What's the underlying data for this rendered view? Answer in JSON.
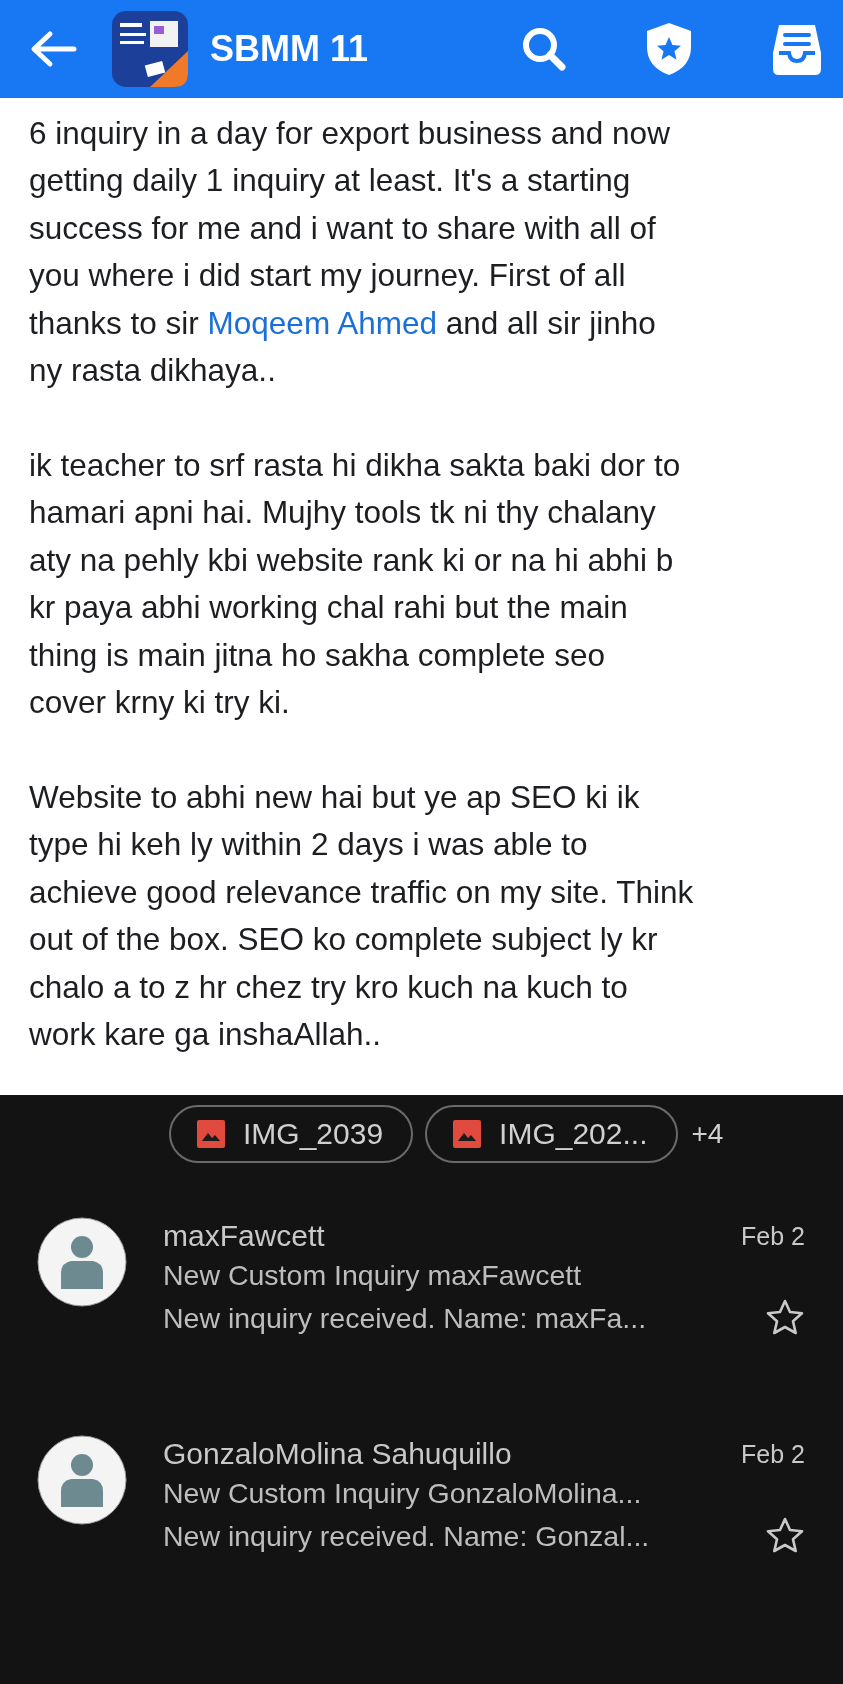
{
  "header": {
    "title": "SBMM 11"
  },
  "post": {
    "paragraphs": [
      {
        "parts": [
          {
            "kind": "text",
            "text": "6 inquiry in a day for export business and now\ngetting daily 1 inquiry at least. It's a starting\nsuccess for me and i want to share with all of\nyou where i did start my journey. First of all\nthanks to sir "
          },
          {
            "kind": "link",
            "text": "Moqeem Ahmed"
          },
          {
            "kind": "text",
            "text": " and all sir jinho\nny rasta dikhaya.."
          }
        ]
      },
      {
        "parts": [
          {
            "kind": "text",
            "text": " ik teacher to srf rasta hi dikha sakta baki dor to\nhamari apni hai. Mujhy tools tk ni thy chalany\naty na pehly kbi website rank ki or na hi abhi b\nkr paya abhi working chal rahi but the main\nthing is main jitna ho sakha complete seo\ncover krny ki try ki."
          }
        ]
      },
      {
        "parts": [
          {
            "kind": "text",
            "text": "Website to abhi new hai but ye ap SEO ki ik\ntype hi keh ly within 2 days i was able to\nachieve good relevance traffic on my site. Think\nout of the box. SEO ko complete subject ly kr\nchalo a to z hr chez try kro kuch na kuch to\nwork kare ga inshaAllah.."
          }
        ]
      }
    ]
  },
  "screenshot": {
    "attachments": [
      "IMG_2039",
      "IMG_202..."
    ],
    "more": "+4",
    "emails": [
      {
        "sender": "maxFawcett",
        "date": "Feb 2",
        "subject": "New Custom Inquiry maxFawcett",
        "snippet": "New inquiry received. Name: maxFa...",
        "starred": false
      },
      {
        "sender": "GonzaloMolina Sahuquillo",
        "date": "Feb 2",
        "subject": "New Custom Inquiry GonzaloMolina...",
        "snippet": "New inquiry received. Name: Gonzal...",
        "starred": false
      }
    ]
  }
}
